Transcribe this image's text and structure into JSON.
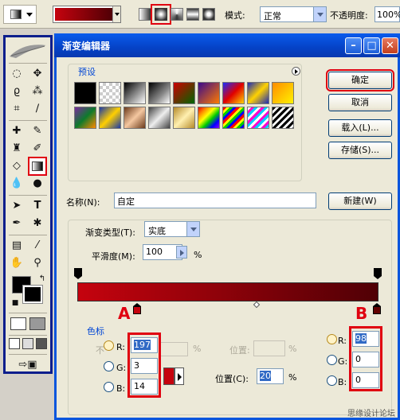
{
  "options_bar": {
    "mode_label": "模式:",
    "mode_value": "正常",
    "opacity_label": "不透明度:",
    "opacity_value": "100%",
    "gradient_colors": [
      "#c5030e",
      "#500005"
    ]
  },
  "dialog": {
    "title": "渐变编辑器",
    "presets_label": "预设",
    "buttons": {
      "ok": "确定",
      "cancel": "取消",
      "load": "载入(L)...",
      "save": "存储(S)...",
      "new": "新建(W)"
    },
    "name_label": "名称(N):",
    "name_value": "自定",
    "gradient_type_label": "渐变类型(T):",
    "gradient_type_value": "实底",
    "smoothness_label": "平滑度(M):",
    "smoothness_value": "100",
    "smoothness_unit": "%",
    "color_stops_label": "色标",
    "left_color": {
      "r_label": "R:",
      "r": "197",
      "g_label": "G:",
      "g": "3",
      "b_label": "B:",
      "b": "14",
      "hex": "#c5030e",
      "pct": "%"
    },
    "right_color": {
      "r_label": "R:",
      "r": "98",
      "g_label": "G:",
      "g": "0",
      "b_label": "B:",
      "b": "0",
      "hex": "#620000"
    },
    "location_label": "位置:",
    "location2_label": "位置(C):",
    "location_value": "20",
    "location_unit": "%",
    "disabled_prefix": "不",
    "disabled_pct": "%"
  },
  "annotations": {
    "a": "A",
    "b": "B"
  },
  "watermark": "思缘设计论坛"
}
